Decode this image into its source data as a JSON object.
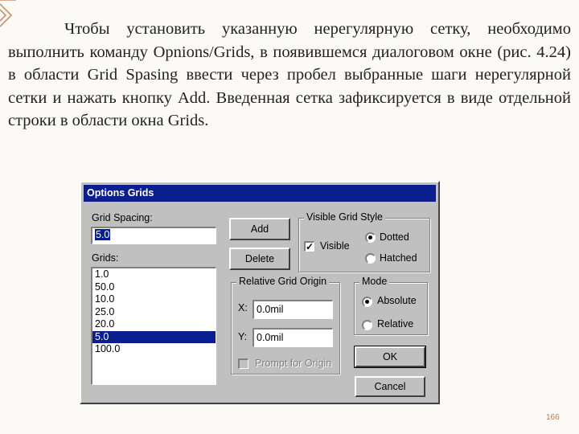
{
  "slide": {
    "paragraph": "Чтобы установить указанную нерегулярную сетку, необходимо выполнить команду Opnions/Grids, в появившемся диалоговом окне (рис. 4.24) в области Grid Spasing ввести через пробел выбранные шаги нерегулярной сетки и нажать кнопку Add. Введенная сетка зафиксируется в виде отдельной строки в области окна Grids.",
    "page_number": "166"
  },
  "dialog": {
    "title": "Options Grids",
    "grid_spacing_label": "Grid Spacing:",
    "grid_spacing_value": "5.0",
    "grids_label": "Grids:",
    "grids_items": [
      "1.0",
      "50.0",
      "10.0",
      "25.0",
      "20.0",
      "5.0",
      "100.0"
    ],
    "grids_selected": "5.0",
    "add_button": "Add",
    "delete_button": "Delete",
    "visible_grid_style": {
      "legend": "Visible Grid Style",
      "visible_label": "Visible",
      "visible_checked": true,
      "dotted_label": "Dotted",
      "hatched_label": "Hatched",
      "selected": "Dotted"
    },
    "relative_grid_origin": {
      "legend": "Relative Grid Origin",
      "x_label": "X:",
      "x_value": "0.0mil",
      "y_label": "Y:",
      "y_value": "0.0mil",
      "prompt_label": "Prompt for Origin",
      "prompt_checked": false
    },
    "mode": {
      "legend": "Mode",
      "absolute_label": "Absolute",
      "relative_label": "Relative",
      "selected": "Absolute"
    },
    "ok_button": "OK",
    "cancel_button": "Cancel"
  },
  "colors": {
    "titlebar": "#0a1f8f",
    "dialog_face": "#c0c0c0",
    "ornament": "#c9926a",
    "page_number": "#c07a55"
  }
}
